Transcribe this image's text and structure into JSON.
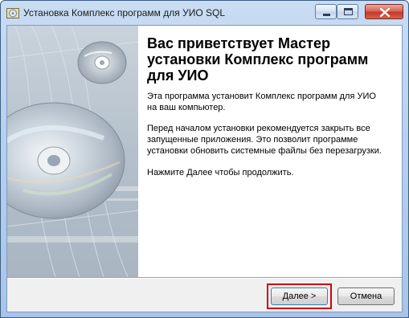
{
  "window": {
    "title": "Установка Комплекс программ для УИО SQL"
  },
  "icons": {
    "app": "installer-disc-icon",
    "minimize": "minimize-icon",
    "maximize": "maximize-icon",
    "close": "close-icon"
  },
  "wizard": {
    "heading": "Вас приветствует Мастер установки Комплекс программ для УИО",
    "paragraph1": "Эта программа установит Комплекс программ для УИО на ваш компьютер.",
    "paragraph2": "Перед началом установки рекомендуется закрыть все запущенные приложения. Это позволит программе установки обновить системные файлы без перезагрузки.",
    "paragraph3": "Нажмите Далее чтобы продолжить."
  },
  "buttons": {
    "next": "Далее >",
    "cancel": "Отмена"
  },
  "colors": {
    "highlight": "#d4000f",
    "titlebar": "#b9d1ee"
  }
}
